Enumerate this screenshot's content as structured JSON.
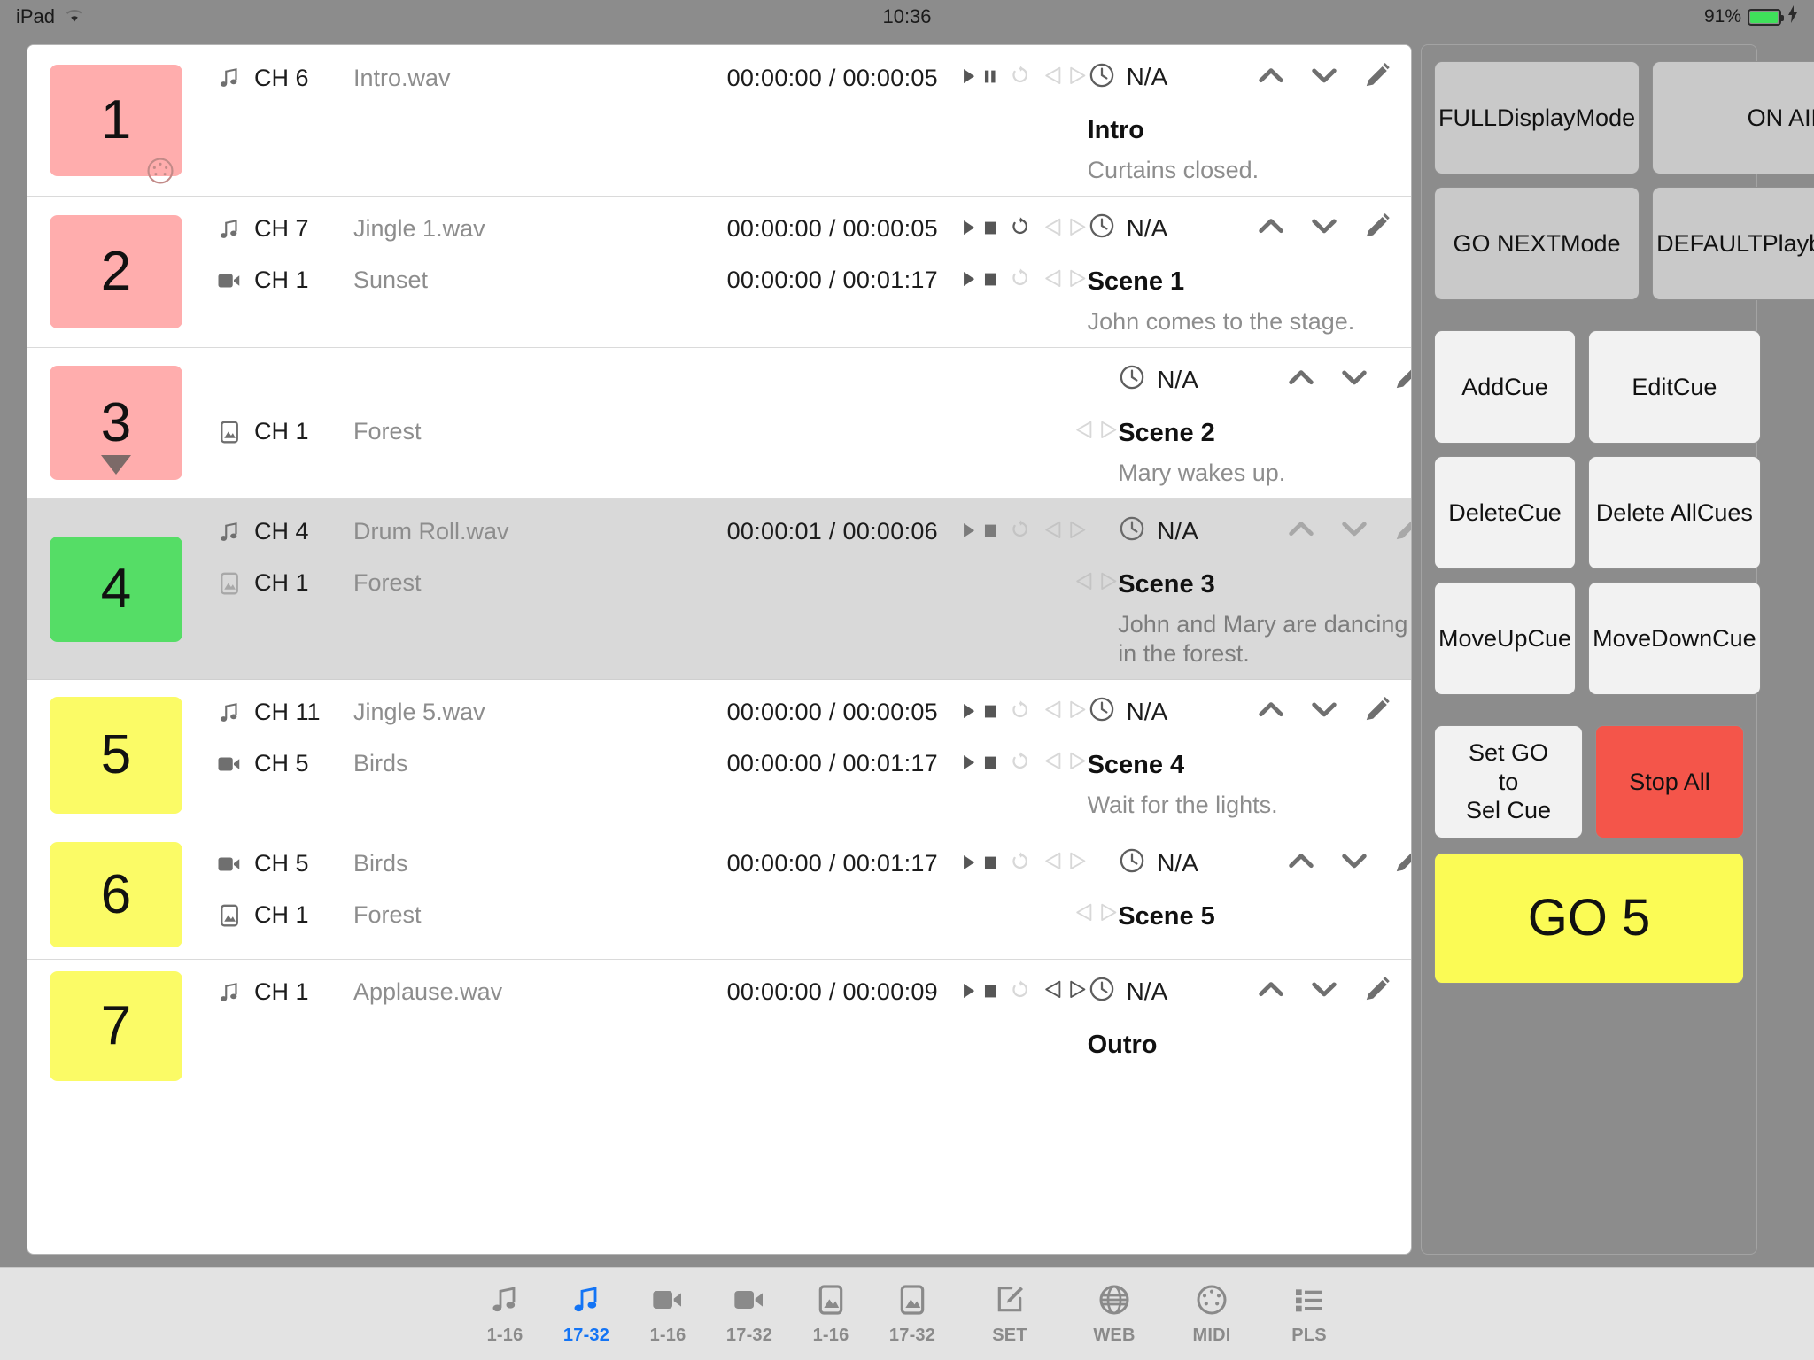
{
  "statusbar": {
    "device": "iPad",
    "wifi_icon": "wifi-icon",
    "time": "10:36",
    "battery_percent": "91%",
    "battery_icon": "battery-charging-icon"
  },
  "colors": {
    "cue_pink": "#ffadad",
    "cue_green": "#55dd66",
    "cue_yellow": "#fbfb66",
    "accent_blue": "#1374f5",
    "stop_red": "#f4554a",
    "go_yellow": "#fbfb55",
    "selected_row": "#d9d9d9"
  },
  "cues": [
    {
      "number": "1",
      "box_color": "#ffadad",
      "badge": "midi-icon",
      "selected": false,
      "tracks": [
        {
          "type_icon": "music-note-icon",
          "channel": "CH 6",
          "name": "Intro.wav",
          "time": "00:00:00 / 00:00:05",
          "controls": {
            "play": "play-icon",
            "stop_or_pause": "pause-icon",
            "loop": "loop-icon",
            "loop_on": false,
            "fade_in": "fade-in-icon",
            "fade_out": "fade-out-icon",
            "fade_on": false
          }
        }
      ],
      "clock_icon": "clock-icon",
      "clock_value": "N/A",
      "title": "Intro",
      "description": "Curtains closed.",
      "actions": [
        "chevron-up-icon",
        "chevron-down-icon",
        "pencil-icon",
        "trash-icon"
      ]
    },
    {
      "number": "2",
      "box_color": "#ffadad",
      "badge": "",
      "selected": false,
      "tracks": [
        {
          "type_icon": "music-note-icon",
          "channel": "CH 7",
          "name": "Jingle 1.wav",
          "time": "00:00:00 / 00:00:05",
          "controls": {
            "play": "play-icon",
            "stop_or_pause": "stop-icon",
            "loop": "loop-icon",
            "loop_on": true,
            "fade_in": "fade-in-icon",
            "fade_out": "fade-out-icon",
            "fade_on": false
          }
        },
        {
          "type_icon": "video-icon",
          "channel": "CH 1",
          "name": "Sunset",
          "time": "00:00:00 / 00:01:17",
          "controls": {
            "play": "play-icon",
            "stop_or_pause": "stop-icon",
            "loop": "loop-icon",
            "loop_on": false,
            "fade_in": "fade-in-icon",
            "fade_out": "fade-out-icon",
            "fade_on": false
          }
        }
      ],
      "clock_icon": "clock-icon",
      "clock_value": "N/A",
      "title": "Scene 1",
      "description": "John comes to the stage.",
      "actions": [
        "chevron-up-icon",
        "chevron-down-icon",
        "pencil-icon",
        "trash-icon"
      ]
    },
    {
      "number": "3",
      "box_color": "#ffadad",
      "badge": "triangle-down-icon",
      "selected": false,
      "tracks": [
        {
          "type_icon": "",
          "channel": "",
          "name": "",
          "time": "",
          "controls": null
        },
        {
          "type_icon": "image-icon",
          "channel": "CH 1",
          "name": "Forest",
          "time": "",
          "controls": {
            "play": "",
            "stop_or_pause": "",
            "loop": "",
            "loop_on": false,
            "fade_in": "fade-in-icon",
            "fade_out": "fade-out-icon",
            "fade_on": false
          }
        }
      ],
      "clock_icon": "clock-icon",
      "clock_value": "N/A",
      "title": "Scene 2",
      "description": "Mary wakes up.",
      "actions": [
        "chevron-up-icon",
        "chevron-down-icon",
        "pencil-icon",
        "trash-icon"
      ]
    },
    {
      "number": "4",
      "box_color": "#55dd66",
      "badge": "",
      "selected": true,
      "tracks": [
        {
          "type_icon": "music-note-icon",
          "channel": "CH 4",
          "name": "Drum Roll.wav",
          "time": "00:00:01 / 00:00:06",
          "controls": {
            "play": "play-icon",
            "stop_or_pause": "stop-icon",
            "loop": "loop-icon",
            "loop_on": false,
            "fade_in": "fade-in-icon",
            "fade_out": "fade-out-icon",
            "fade_on": false
          }
        },
        {
          "type_icon": "image-icon",
          "channel": "CH 1",
          "name": "Forest",
          "time": "",
          "controls": {
            "play": "",
            "stop_or_pause": "",
            "loop": "",
            "loop_on": false,
            "fade_in": "fade-in-icon",
            "fade_out": "fade-out-icon",
            "fade_on": false
          }
        }
      ],
      "clock_icon": "clock-icon",
      "clock_value": "N/A",
      "title": "Scene 3",
      "description": "John and Mary are dancing in the forest.",
      "actions": [
        "chevron-up-icon",
        "chevron-down-icon",
        "pencil-icon",
        "trash-icon"
      ]
    },
    {
      "number": "5",
      "box_color": "#fbfb66",
      "badge": "",
      "selected": false,
      "tracks": [
        {
          "type_icon": "music-note-icon",
          "channel": "CH 11",
          "name": "Jingle 5.wav",
          "time": "00:00:00 / 00:00:05",
          "controls": {
            "play": "play-icon",
            "stop_or_pause": "stop-icon",
            "loop": "loop-icon",
            "loop_on": false,
            "fade_in": "fade-in-icon",
            "fade_out": "fade-out-icon",
            "fade_on": false
          }
        },
        {
          "type_icon": "video-icon",
          "channel": "CH 5",
          "name": "Birds",
          "time": "00:00:00 / 00:01:17",
          "controls": {
            "play": "play-icon",
            "stop_or_pause": "stop-icon",
            "loop": "loop-icon",
            "loop_on": false,
            "fade_in": "fade-in-icon",
            "fade_out": "fade-out-icon",
            "fade_on": false
          }
        }
      ],
      "clock_icon": "clock-icon",
      "clock_value": "N/A",
      "title": "Scene 4",
      "description": "Wait for the lights.",
      "actions": [
        "chevron-up-icon",
        "chevron-down-icon",
        "pencil-icon",
        "trash-icon"
      ]
    },
    {
      "number": "6",
      "box_color": "#fbfb66",
      "badge": "",
      "selected": false,
      "tracks": [
        {
          "type_icon": "video-icon",
          "channel": "CH 5",
          "name": "Birds",
          "time": "00:00:00 / 00:01:17",
          "controls": {
            "play": "play-icon",
            "stop_or_pause": "stop-icon",
            "loop": "loop-icon",
            "loop_on": false,
            "fade_in": "fade-in-icon",
            "fade_out": "fade-out-icon",
            "fade_on": false
          }
        },
        {
          "type_icon": "image-icon",
          "channel": "CH 1",
          "name": "Forest",
          "time": "",
          "controls": {
            "play": "",
            "stop_or_pause": "",
            "loop": "",
            "loop_on": false,
            "fade_in": "fade-in-icon",
            "fade_out": "fade-out-icon",
            "fade_on": false
          }
        }
      ],
      "clock_icon": "clock-icon",
      "clock_value": "N/A",
      "title": "Scene 5",
      "description": "",
      "actions": [
        "chevron-up-icon",
        "chevron-down-icon",
        "pencil-icon",
        "trash-icon"
      ]
    },
    {
      "number": "7",
      "box_color": "#fbfb66",
      "badge": "",
      "selected": false,
      "tracks": [
        {
          "type_icon": "music-note-icon",
          "channel": "CH 1",
          "name": "Applause.wav",
          "time": "00:00:00 / 00:00:09",
          "controls": {
            "play": "play-icon",
            "stop_or_pause": "stop-icon",
            "loop": "loop-icon",
            "loop_on": false,
            "fade_in": "fade-in-icon",
            "fade_out": "fade-out-icon",
            "fade_on": true
          }
        }
      ],
      "clock_icon": "clock-icon",
      "clock_value": "N/A",
      "title": "Outro",
      "description": "",
      "actions": [
        "chevron-up-icon",
        "chevron-down-icon",
        "pencil-icon",
        "trash-icon"
      ]
    }
  ],
  "sidepanel": {
    "mode_buttons": [
      {
        "label": "FULL\nDisplay\nMode",
        "name": "full-display-mode-button"
      },
      {
        "label": "ON AIR",
        "name": "on-air-button"
      },
      {
        "label": "GO NEXT\nMode",
        "name": "go-next-mode-button"
      },
      {
        "label": "DEFAULT\nPlayback\nMode",
        "name": "default-playback-mode-button"
      }
    ],
    "action_buttons": [
      {
        "label": "Add\nCue",
        "name": "add-cue-button"
      },
      {
        "label": "Edit\nCue",
        "name": "edit-cue-button"
      },
      {
        "label": "Delete\nCue",
        "name": "delete-cue-button"
      },
      {
        "label": "Delete All\nCues",
        "name": "delete-all-cues-button"
      },
      {
        "label": "Move\nUp\nCue",
        "name": "move-up-cue-button"
      },
      {
        "label": "Move\nDown\nCue",
        "name": "move-down-cue-button"
      }
    ],
    "set_go_label": "Set GO\nto\nSel Cue",
    "stop_all_label": "Stop All",
    "go_label": "GO 5"
  },
  "tabbar": [
    {
      "icon": "music-note-icon",
      "label": "1-16",
      "active": false
    },
    {
      "icon": "music-note-icon",
      "label": "17-32",
      "active": true
    },
    {
      "icon": "video-icon",
      "label": "1-16",
      "active": false
    },
    {
      "icon": "video-icon",
      "label": "17-32",
      "active": false
    },
    {
      "icon": "image-icon",
      "label": "1-16",
      "active": false
    },
    {
      "icon": "image-icon",
      "label": "17-32",
      "active": false
    },
    {
      "icon": "pencil-square-icon",
      "label": "SET",
      "active": false
    },
    {
      "icon": "globe-icon",
      "label": "WEB",
      "active": false
    },
    {
      "icon": "midi-icon",
      "label": "MIDI",
      "active": false
    },
    {
      "icon": "list-icon",
      "label": "PLS",
      "active": false
    }
  ]
}
